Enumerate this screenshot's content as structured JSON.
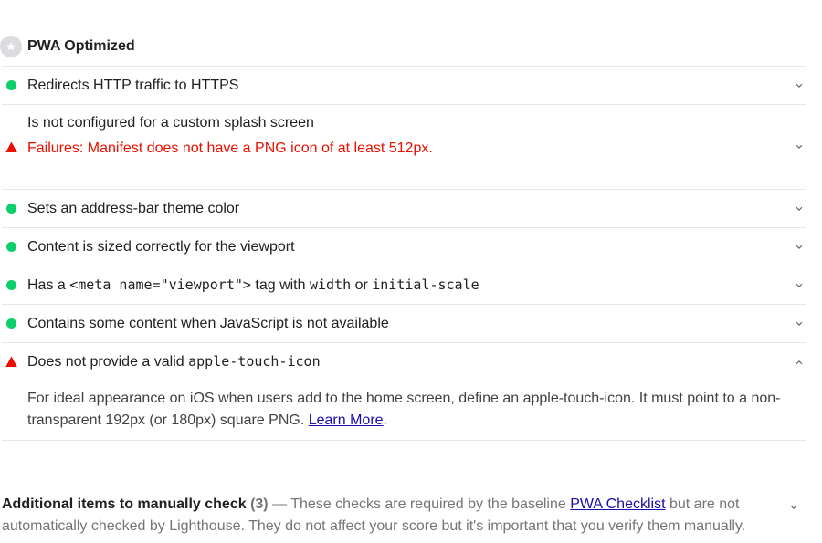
{
  "group": {
    "title": "PWA Optimized",
    "icon": "star-icon"
  },
  "audits": [
    {
      "title": "Redirects HTTP traffic to HTTPS",
      "status": "pass"
    },
    {
      "title": "Is not configured for a custom splash screen",
      "status": "fail",
      "failure": "Failures: Manifest does not have a PNG icon of at least 512px."
    },
    {
      "title": "Sets an address-bar theme color",
      "status": "pass"
    },
    {
      "title": "Content is sized correctly for the viewport",
      "status": "pass"
    },
    {
      "title_parts": [
        "Has a ",
        "<meta name=\"viewport\">",
        " tag with ",
        "width",
        " or ",
        "initial-scale"
      ],
      "status": "pass"
    },
    {
      "title": "Contains some content when JavaScript is not available",
      "status": "pass"
    },
    {
      "title_parts": [
        "Does not provide a valid ",
        "apple-touch-icon"
      ],
      "status": "fail",
      "expanded": true,
      "description": "For ideal appearance on iOS when users add to the home screen, define an apple-touch-icon. It must point to a non-transparent 192px (or 180px) square PNG. ",
      "link": "Learn More",
      "description_end": "."
    }
  ],
  "manual": {
    "title": "Additional items to manually check",
    "count": "(3)",
    "dash": "—",
    "text_before": "These checks are required by the baseline ",
    "link": "PWA Checklist",
    "text_after": " but are not automatically checked by Lighthouse. They do not affect your score but it's important that you verify them manually."
  },
  "colors": {
    "pass": "#0cce6b",
    "fail": "#eb0f00",
    "link": "#1a0dab"
  }
}
